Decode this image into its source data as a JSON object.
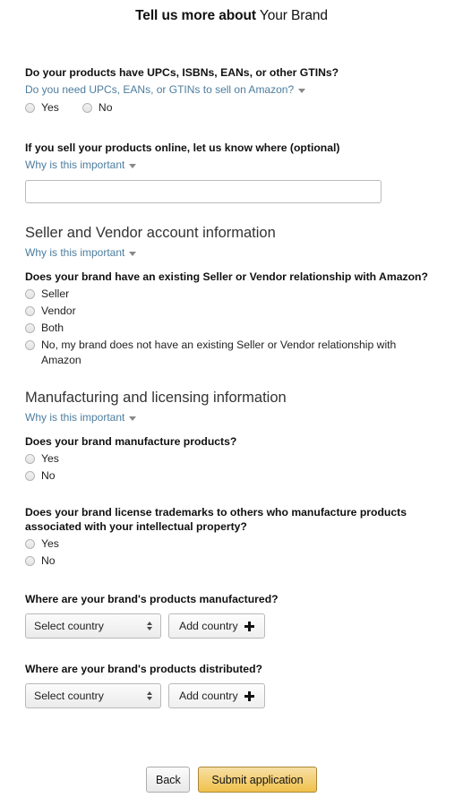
{
  "header": {
    "title_strong": "Tell us more about",
    "title_light": "Your Brand"
  },
  "gtin": {
    "question": "Do your products have UPCs, ISBNs, EANs, or other GTINs?",
    "expander_label": "Do you need UPCs, EANs, or GTINs to sell on Amazon?",
    "options": [
      "Yes",
      "No"
    ]
  },
  "online_sales": {
    "question": "If you sell your products online, let us know where (optional)",
    "expander_label": "Why is this important",
    "input_value": "",
    "input_placeholder": ""
  },
  "seller_vendor": {
    "heading": "Seller and Vendor account information",
    "expander_label": "Why is this important",
    "question": "Does your brand have an existing Seller or Vendor relationship with Amazon?",
    "options": [
      "Seller",
      "Vendor",
      "Both",
      "No, my brand does not have an existing Seller or Vendor relationship with Amazon"
    ]
  },
  "manufacturing": {
    "heading": "Manufacturing and licensing information",
    "expander_label": "Why is this important",
    "manufacture_question": "Does your brand manufacture products?",
    "manufacture_options": [
      "Yes",
      "No"
    ],
    "license_question": "Does your brand license trademarks to others who manufacture products associated with your intellectual property?",
    "license_options": [
      "Yes",
      "No"
    ],
    "manufactured_where_question": "Where are your brand's products manufactured?",
    "distributed_where_question": "Where are your brand's products distributed?",
    "select_placeholder": "Select country",
    "add_country_label": "Add country"
  },
  "footer": {
    "back_label": "Back",
    "submit_label": "Submit application"
  },
  "colors": {
    "link": "#4c7d9e",
    "submit_bg_top": "#f7dfa5",
    "submit_bg_bottom": "#f0c14b",
    "submit_border": "#a88734",
    "heading_text": "#333333",
    "body_text": "#111111"
  }
}
